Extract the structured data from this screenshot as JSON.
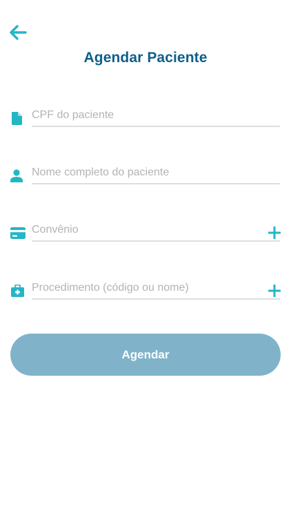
{
  "header": {
    "back_icon": "arrow-left-icon",
    "title": "Agendar Paciente"
  },
  "form": {
    "fields": [
      {
        "icon": "document-icon",
        "placeholder": "CPF do paciente",
        "value": "",
        "has_add": false
      },
      {
        "icon": "person-icon",
        "placeholder": "Nome completo do paciente",
        "value": "",
        "has_add": false
      },
      {
        "icon": "credit-card-icon",
        "placeholder": "Convênio",
        "value": "",
        "has_add": true
      },
      {
        "icon": "medical-kit-icon",
        "placeholder": "Procedimento (código ou nome)",
        "value": "",
        "has_add": true
      }
    ],
    "submit_label": "Agendar"
  },
  "colors": {
    "accent": "#23b6c6",
    "title": "#0e5f8a",
    "button": "#80b3c9",
    "underline": "#dedede",
    "placeholder": "#b3b3b3"
  }
}
